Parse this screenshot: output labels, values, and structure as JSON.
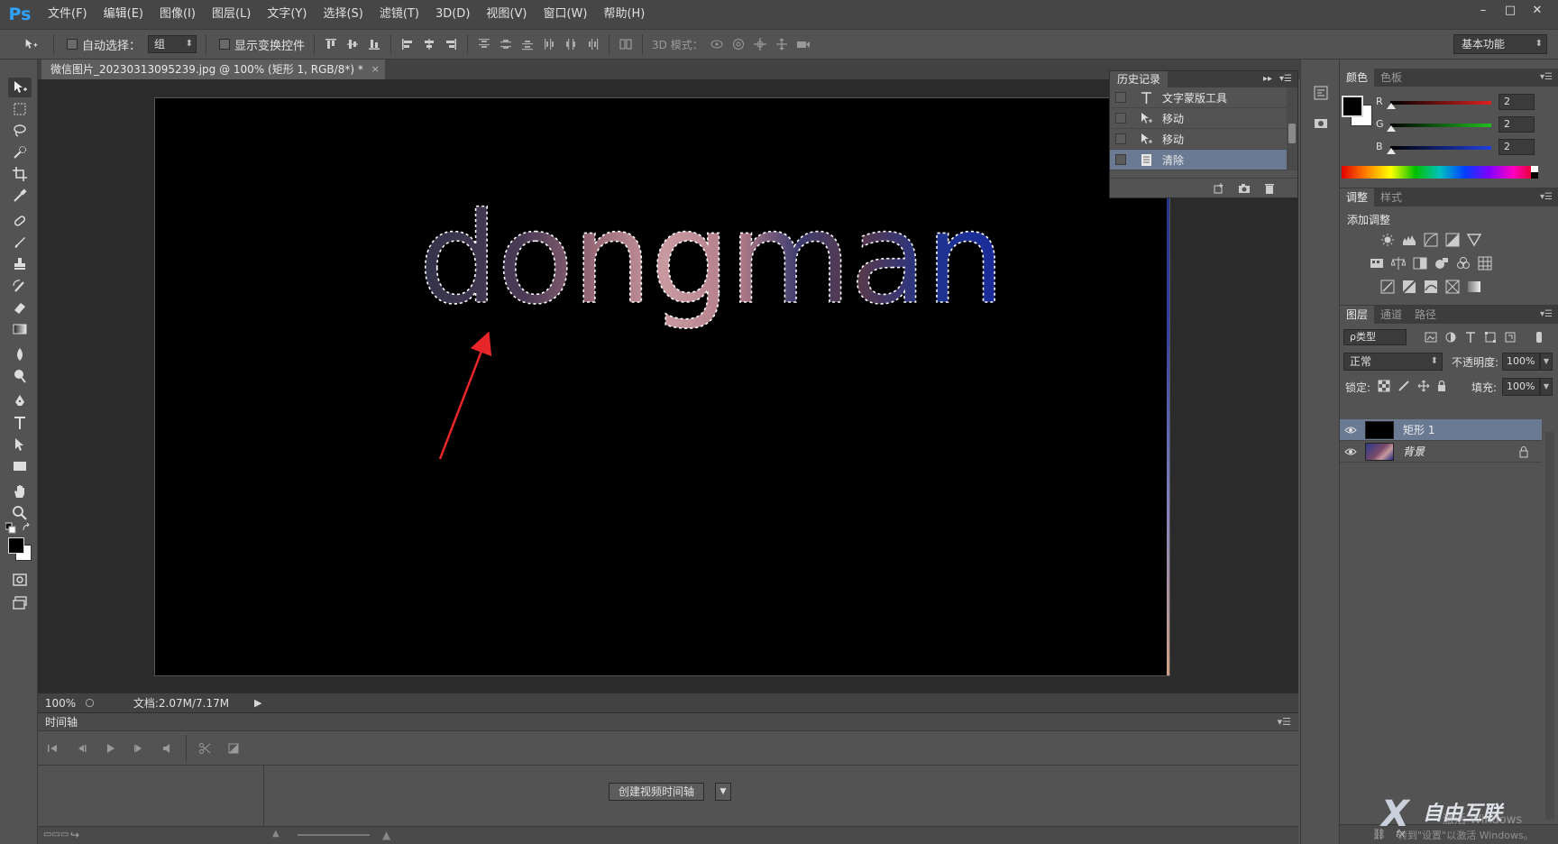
{
  "app": {
    "logo": "Ps",
    "menu": [
      "文件(F)",
      "编辑(E)",
      "图像(I)",
      "图层(L)",
      "文字(Y)",
      "选择(S)",
      "滤镜(T)",
      "3D(D)",
      "视图(V)",
      "窗口(W)",
      "帮助(H)"
    ],
    "window_controls": [
      "–",
      "□",
      "✕"
    ]
  },
  "options_bar": {
    "auto_select_label": "自动选择：",
    "auto_select_value": "组",
    "show_transform_label": "显示变换控件",
    "mode_3d_label": "3D 模式：",
    "workspace": "基本功能"
  },
  "document": {
    "tab_title": "微信图片_20230313095239.jpg @ 100% (矩形 1, RGB/8*) *",
    "close": "×",
    "canvas_text": "dongman",
    "arrow_color": "#e8262a"
  },
  "status": {
    "zoom": "100%",
    "doc_size": "文档:2.07M/7.17M",
    "arrow": "▶"
  },
  "timeline": {
    "title": "时间轴",
    "create_button": "创建视频时间轴",
    "dropdown": "▼"
  },
  "history": {
    "tab": "历史记录",
    "items": [
      {
        "label": "文字蒙版工具",
        "icon": "T"
      },
      {
        "label": "移动",
        "icon": "move"
      },
      {
        "label": "移动",
        "icon": "move"
      },
      {
        "label": "清除",
        "icon": "doc"
      }
    ],
    "selected_index": 3
  },
  "color_panel": {
    "tabs": [
      "颜色",
      "色板"
    ],
    "channels": [
      {
        "label": "R",
        "value": "2",
        "color": "#e02020"
      },
      {
        "label": "G",
        "value": "2",
        "color": "#20c020"
      },
      {
        "label": "B",
        "value": "2",
        "color": "#2040e0"
      }
    ]
  },
  "adjust_panel": {
    "tabs": [
      "调整",
      "样式"
    ],
    "title": "添加调整"
  },
  "layers_panel": {
    "tabs": [
      "图层",
      "通道",
      "路径"
    ],
    "filter": "ρ类型",
    "blend_mode": "正常",
    "opacity_label": "不透明度:",
    "opacity": "100%",
    "lock_label": "锁定:",
    "fill_label": "填充:",
    "fill": "100%",
    "layers": [
      {
        "name": "矩形 1",
        "selected": true
      },
      {
        "name": "背景",
        "selected": false,
        "locked": true
      }
    ]
  },
  "watermark": {
    "logo": "X",
    "text": "自由互联",
    "activate": "激活 Windows",
    "sub": "转到\"设置\"以激活 Windows。"
  }
}
